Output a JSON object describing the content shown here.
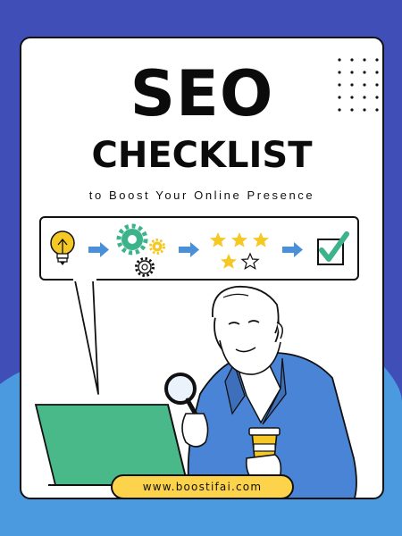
{
  "poster": {
    "title_line1": "SEO",
    "title_line2": "CHECKLIST",
    "subtitle": "to Boost Your Online Presence",
    "website": "www.boostifai.com"
  },
  "process_steps": [
    {
      "icon": "lightbulb-icon"
    },
    {
      "icon": "gears-icon"
    },
    {
      "icon": "stars-rating-icon"
    },
    {
      "icon": "checkbox-checked-icon"
    }
  ],
  "colors": {
    "background": "#3f4fb7",
    "background_wave": "#4b9ae0",
    "arrow": "#4a90d9",
    "gear_green": "#3cb38a",
    "star_yellow": "#f6c825",
    "check_green": "#3cb38a",
    "laptop_green": "#49b98a",
    "jacket_blue": "#4a84d6",
    "url_pill": "#fcd34a"
  }
}
